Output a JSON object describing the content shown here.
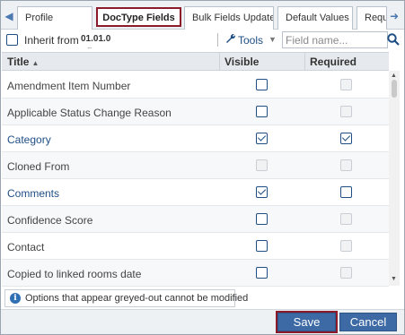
{
  "tabs": [
    {
      "label": "Profile"
    },
    {
      "label": "DocType Fields"
    },
    {
      "label": "Bulk Fields Update"
    },
    {
      "label": "Default Values"
    },
    {
      "label": "Requ"
    }
  ],
  "toolbar": {
    "inherit_label": "Inherit from",
    "inherit_version": "01.01.0",
    "inherit_ellipsis": "...",
    "tools_label": "Tools",
    "field_placeholder": "Field name..."
  },
  "grid": {
    "columns": {
      "title": "Title",
      "visible": "Visible",
      "required": "Required"
    },
    "rows": [
      {
        "title": "Amendment Item Number",
        "visible": false,
        "required": false,
        "required_disabled": true,
        "link": false
      },
      {
        "title": "Applicable Status Change Reason",
        "visible": false,
        "required": false,
        "required_disabled": true,
        "link": false
      },
      {
        "title": "Category",
        "visible": true,
        "required": true,
        "required_disabled": false,
        "link": true
      },
      {
        "title": "Cloned From",
        "visible": false,
        "visible_disabled": true,
        "required": false,
        "required_disabled": true,
        "link": false
      },
      {
        "title": "Comments",
        "visible": true,
        "required": false,
        "required_disabled": false,
        "link": true
      },
      {
        "title": "Confidence Score",
        "visible": false,
        "required": false,
        "required_disabled": true,
        "link": false
      },
      {
        "title": "Contact",
        "visible": false,
        "required": false,
        "required_disabled": true,
        "link": false
      },
      {
        "title": "Copied to linked rooms date",
        "visible": false,
        "required": false,
        "required_disabled": true,
        "link": false
      }
    ]
  },
  "info": {
    "text": "Options that appear greyed-out cannot be modified",
    "icon": "info-icon"
  },
  "footer": {
    "save_label": "Save",
    "cancel_label": "Cancel"
  },
  "colors": {
    "accent": "#3d6aa5",
    "highlight_border": "#8b1a2b",
    "link": "#1f4e85"
  }
}
